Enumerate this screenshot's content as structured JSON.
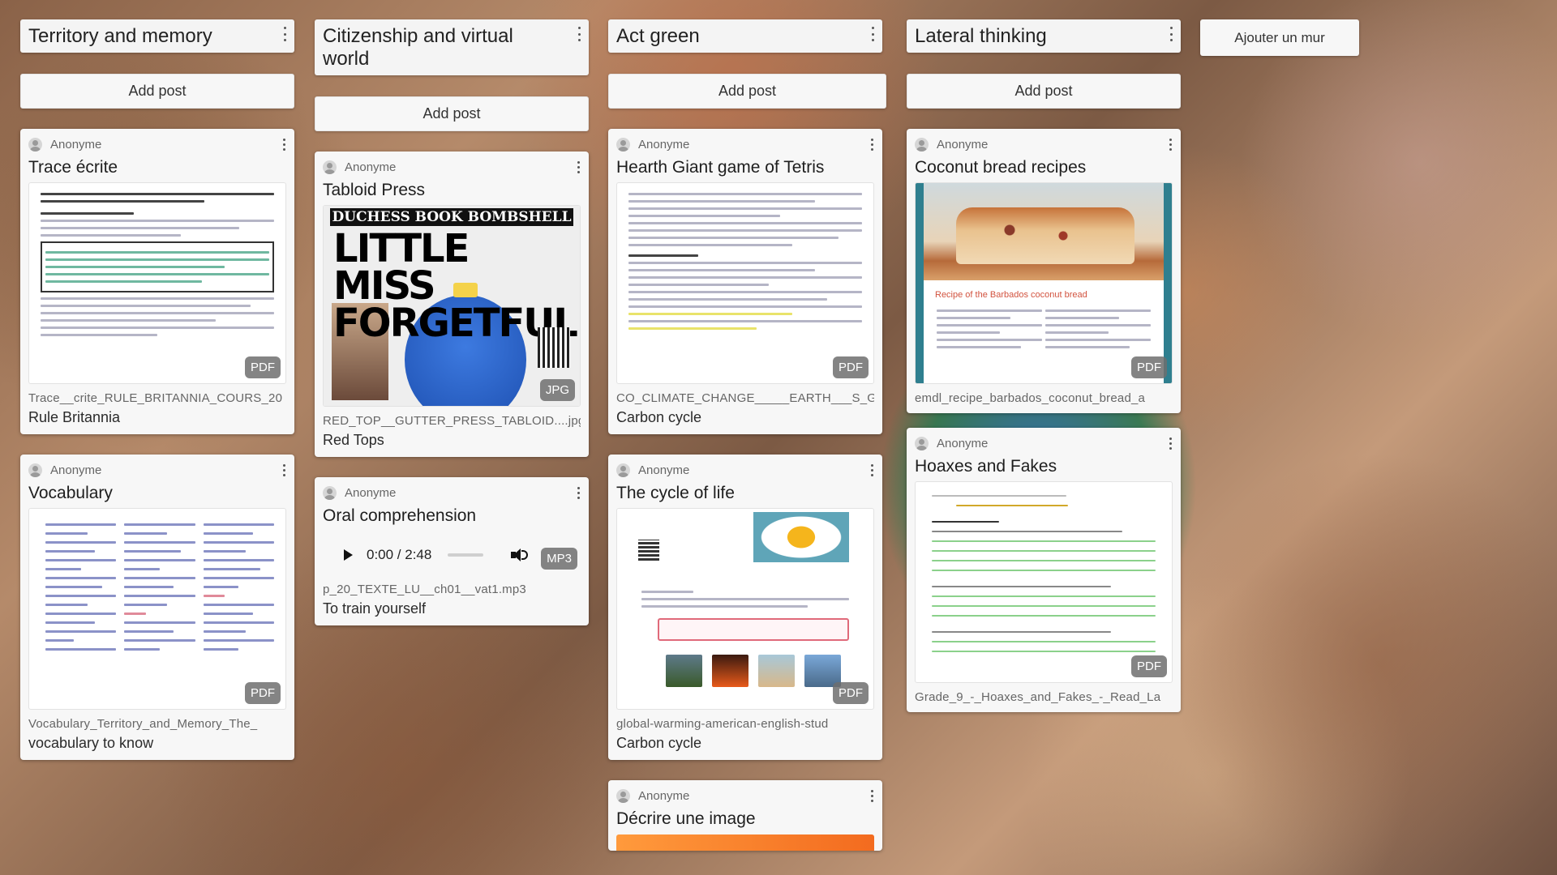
{
  "board": {
    "add_wall_label": "Ajouter un mur"
  },
  "columns": [
    {
      "title": "Territory and memory",
      "add_post_label": "Add post",
      "cards": [
        {
          "author": "Anonyme",
          "title": "Trace écrite",
          "badge": "PDF",
          "filename": "Trace__crite_RULE_BRITANNIA_COURS_20",
          "caption": "Rule Britannia"
        },
        {
          "author": "Anonyme",
          "title": "Vocabulary",
          "badge": "PDF",
          "filename": "Vocabulary_Territory_and_Memory_The_",
          "caption": "vocabulary to know"
        }
      ]
    },
    {
      "title": "Citizenship and virtual world",
      "add_post_label": "Add post",
      "cards": [
        {
          "author": "Anonyme",
          "title": "Tabloid Press",
          "badge": "JPG",
          "filename": "RED_TOP__GUTTER_PRESS_TABLOID....jpg",
          "caption": "Red Tops",
          "thumb_head": "DUCHESS BOOK BOMBSHELL",
          "thumb_big": "LITTLE MISS FORGETFUL"
        },
        {
          "author": "Anonyme",
          "title": "Oral comprehension",
          "badge": "MP3",
          "audio_time": "0:00 / 2:48",
          "filename": "p_20_TEXTE_LU__ch01__vat1.mp3",
          "caption": "To train yourself"
        }
      ]
    },
    {
      "title": "Act green",
      "add_post_label": "Add post",
      "cards": [
        {
          "author": "Anonyme",
          "title": "Hearth Giant game of Tetris",
          "badge": "PDF",
          "filename": "CO_CLIMATE_CHANGE_____EARTH___S_GIA",
          "caption": "Carbon cycle"
        },
        {
          "author": "Anonyme",
          "title": "The cycle of life",
          "badge": "PDF",
          "filename": "global-warming-american-english-stud",
          "caption": "Carbon cycle"
        },
        {
          "author": "Anonyme",
          "title": "Décrire une image"
        }
      ]
    },
    {
      "title": "Lateral thinking",
      "add_post_label": "Add post",
      "cards": [
        {
          "author": "Anonyme",
          "title": "Coconut bread recipes",
          "badge": "PDF",
          "filename": "emdl_recipe_barbados_coconut_bread_a",
          "caption": "",
          "thumb_text": "Recipe of the Barbados coconut bread"
        },
        {
          "author": "Anonyme",
          "title": "Hoaxes and Fakes",
          "badge": "PDF",
          "filename": "Grade_9_-_Hoaxes_and_Fakes_-_Read_La",
          "caption": ""
        }
      ]
    }
  ]
}
